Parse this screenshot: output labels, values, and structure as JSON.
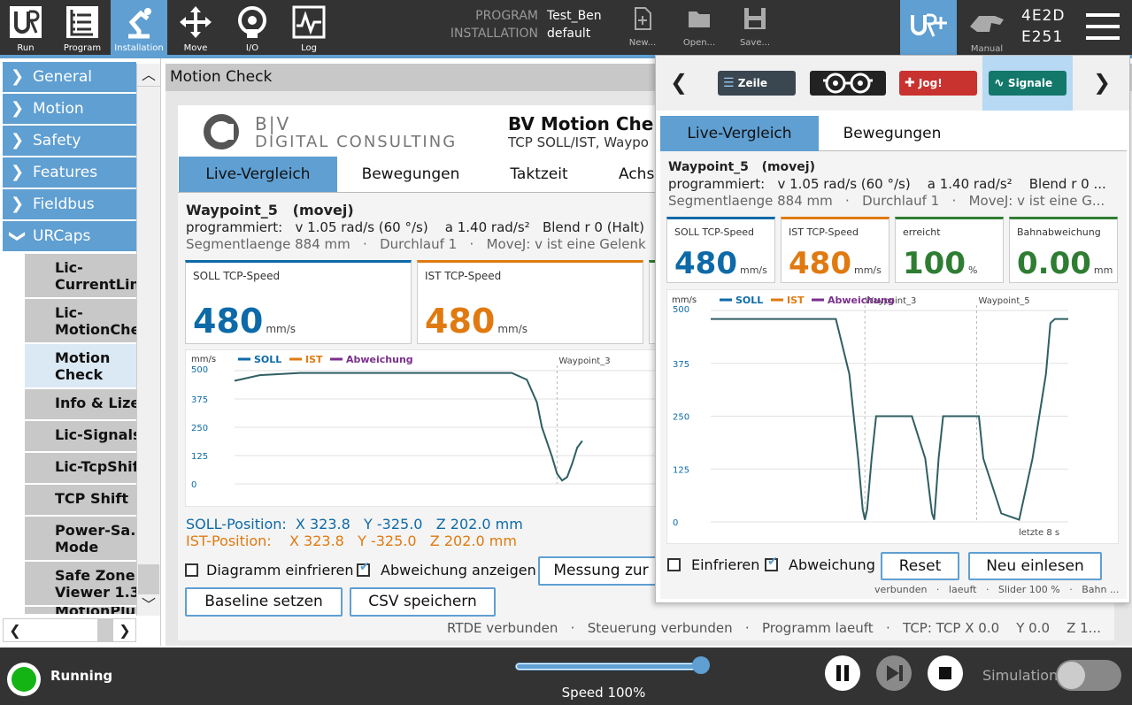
{
  "nav": {
    "run": "Run",
    "program": "Program",
    "installation": "Installation",
    "move": "Move",
    "io": "I/O",
    "log": "Log"
  },
  "program_info": {
    "program_label": "PROGRAM",
    "program_value": "Test_Ben",
    "installation_label": "INSTALLATION",
    "installation_value": "default"
  },
  "file": {
    "new": "New...",
    "open": "Open...",
    "save": "Save..."
  },
  "mode": {
    "label": "Manual"
  },
  "serial": {
    "line1": "4E2D",
    "line2": "E251"
  },
  "sidebar": {
    "items": [
      {
        "label": "General"
      },
      {
        "label": "Motion"
      },
      {
        "label": "Safety"
      },
      {
        "label": "Features"
      },
      {
        "label": "Fieldbus"
      },
      {
        "label": "URCaps"
      }
    ],
    "urcaps": [
      {
        "line1": "Lic-",
        "line2": "CurrentLin"
      },
      {
        "line1": "Lic-",
        "line2": "MotionChe"
      },
      {
        "line1": "Motion",
        "line2": "Check"
      },
      {
        "line1": "Info & Lize",
        "line2": ""
      },
      {
        "line1": "Lic-Signals",
        "line2": ""
      },
      {
        "line1": "Lic-TcpShift",
        "line2": ""
      },
      {
        "line1": "TCP Shift",
        "line2": ""
      },
      {
        "line1": "Power-Sa.",
        "line2": "Mode"
      },
      {
        "line1": "Safe Zone",
        "line2": "Viewer 1.3"
      },
      {
        "line1": "MotionPlu",
        "line2": ""
      }
    ]
  },
  "main": {
    "header": "Motion Check",
    "logo_bv": "B|V",
    "logo_dc": "DIGITAL CONSULTING",
    "app_title": "BV Motion Che",
    "app_subtitle": "TCP SOLL/IST, Waypo",
    "tabs": [
      "Live-Vergleich",
      "Bewegungen",
      "Taktzeit",
      "Achs"
    ],
    "waypoint": "Waypoint_5",
    "movetype": "(movej)",
    "programmed": "programmiert:   v 1.05 rad/s (60 °/s)    a 1.40 rad/s²   Blend r 0 (Halt)",
    "segment": "Segmentlaenge 884 mm   ·   Durchlauf 1   ·   MoveJ: v ist eine Gelenk",
    "cards": [
      {
        "title": "SOLL TCP-Speed",
        "value": "480",
        "unit": "mm/s",
        "color": "#0d6aa8"
      },
      {
        "title": "IST TCP-Speed",
        "value": "480",
        "unit": "mm/s",
        "color": "#e07a10"
      }
    ],
    "chart_legend": {
      "unit": "mm/s",
      "soll": "SOLL",
      "ist": "IST",
      "abw": "Abweichung"
    },
    "soll_pos": "SOLL-Position:  X 323.8   Y -325.0   Z 202.0 mm",
    "ist_pos": "IST-Position:    X 323.8   Y -325.0   Z 202.0 mm",
    "freeze": "Diagramm einfrieren",
    "show_dev": "Abweichung anzeigen",
    "measure_btn": "Messung zur",
    "baseline_btn": "Baseline setzen",
    "csv_btn": "CSV speichern",
    "status": "RTDE verbunden   ·   Steuerung verbunden   ·   Programm laeuft   ·   TCP: TCP X 0.0    Y 0.0    Z 1..."
  },
  "overlay": {
    "pills": {
      "zeile": "Zeile",
      "jog": "Jog!",
      "signale": "Signale"
    },
    "tabs": [
      "Live-Vergleich",
      "Bewegungen"
    ],
    "waypoint": "Waypoint_5",
    "movetype": "(movej)",
    "programmed": "programmiert:   v 1.05 rad/s (60 °/s)    a 1.40 rad/s²    Blend r 0 ...",
    "segment": "Segmentlaenge 884 mm   ·   Durchlauf 1   ·   MoveJ: v ist eine G...",
    "cards": [
      {
        "title": "SOLL TCP-Speed",
        "value": "480",
        "unit": "mm/s",
        "color": "#0d6aa8"
      },
      {
        "title": "IST TCP-Speed",
        "value": "480",
        "unit": "mm/s",
        "color": "#e07a10"
      },
      {
        "title": "erreicht",
        "value": "100",
        "unit": "%",
        "color": "#2e7d32"
      },
      {
        "title": "Bahnabweichung",
        "value": "0.00",
        "unit": "mm",
        "color": "#2e7d32"
      }
    ],
    "chart_legend": {
      "unit": "mm/s",
      "soll": "SOLL",
      "ist": "IST",
      "abw": "Abweichung"
    },
    "last": "letzte 8 s",
    "freeze": "Einfrieren",
    "dev": "Abweichung",
    "reset_btn": "Reset",
    "reload_btn": "Neu einlesen",
    "status": "verbunden   ·   laeuft   ·   Slider 100 %   ·   Bahn ..."
  },
  "bottom": {
    "state": "Running",
    "speed": "Speed 100%",
    "speed_fraction": 1.0,
    "sim": "Simulation"
  },
  "colors": {
    "accent": "#5f9fd2",
    "soll": "#0d6aa8",
    "ist": "#e07a10",
    "abw": "#7b2f8c",
    "ok": "#2e7d32"
  },
  "chart_data": [
    {
      "type": "line",
      "ylabel": "mm/s",
      "ylim": [
        0,
        500
      ],
      "yticks": [
        0,
        125,
        250,
        375,
        500
      ],
      "annotations": [
        "Waypoint_3"
      ],
      "series": [
        {
          "name": "SOLL",
          "x": [
            0,
            0.5,
            1.3,
            2,
            2.5,
            3,
            3.5,
            4,
            4.5,
            5,
            5.5,
            5.8,
            6,
            6.1,
            6.3,
            6.4,
            6.5,
            6.6,
            6.7,
            6.8,
            6.9
          ],
          "values": [
            455,
            480,
            490,
            490,
            490,
            490,
            490,
            490,
            490,
            490,
            490,
            460,
            360,
            250,
            120,
            45,
            15,
            30,
            90,
            160,
            190
          ]
        }
      ]
    },
    {
      "type": "line",
      "ylabel": "mm/s",
      "ylim": [
        0,
        500
      ],
      "yticks": [
        0,
        125,
        250,
        375,
        500
      ],
      "annotations": [
        "Waypoint_3",
        "Waypoint_5"
      ],
      "xlabel": "letzte 8 s",
      "series": [
        {
          "name": "SOLL",
          "x": [
            0,
            0.1,
            0.3,
            0.5,
            1,
            1.5,
            2,
            2.3,
            2.5,
            2.8,
            3.1,
            3.3,
            3.4,
            3.45,
            3.5,
            3.6,
            3.7,
            4,
            4.3,
            4.5,
            4.8,
            4.95,
            5,
            5.1,
            5.2,
            5.5,
            5.8,
            6,
            6.1,
            6.5,
            6.9,
            7.2,
            7.5,
            7.6,
            7.7,
            8
          ],
          "values": [
            480,
            480,
            480,
            480,
            480,
            480,
            480,
            480,
            480,
            480,
            350,
            150,
            30,
            5,
            30,
            150,
            250,
            250,
            250,
            250,
            150,
            20,
            5,
            150,
            250,
            250,
            250,
            250,
            150,
            20,
            5,
            150,
            350,
            470,
            480,
            480
          ]
        }
      ]
    }
  ]
}
